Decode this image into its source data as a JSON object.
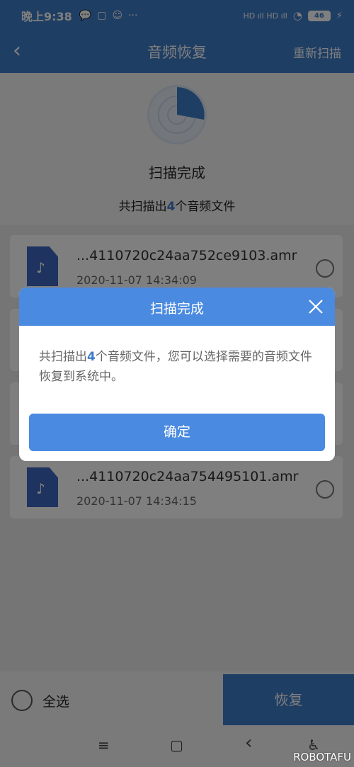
{
  "status_bar": {
    "time": "晚上9:38",
    "app_icons": [
      "💬",
      "▢",
      "☺"
    ],
    "more": "···",
    "signal": "HD ıll HD ıll",
    "wifi": "◔",
    "battery": "46",
    "charging": "⚡"
  },
  "header": {
    "back_icon": "‹",
    "title": "音频恢复",
    "rescan_label": "重新扫描"
  },
  "scan": {
    "status_title": "扫描完成",
    "summary_prefix": "共扫描出",
    "summary_count": "4",
    "summary_suffix": "个音频文件"
  },
  "files": [
    {
      "name": "...4110720c24aa752ce9103.amr",
      "date": "2020-11-07 14:34:09"
    },
    {
      "name": "...4110720c24aa754495101.amr",
      "date": "2020-11-07 14:34:15"
    }
  ],
  "bottom_bar": {
    "select_all_label": "全选",
    "restore_label": "恢复"
  },
  "system_nav": {
    "menu": "≡",
    "home": "▢",
    "back": "‹",
    "accessibility": "♿"
  },
  "watermark": "ROBOTAFU",
  "dialog": {
    "title": "扫描完成",
    "message_prefix": "共扫描出",
    "message_count": "4",
    "message_suffix": "个音频文件，您可以选择需要的音频文件恢复到系统中。",
    "ok_label": "确定"
  },
  "colors": {
    "primary": "#3f7cc8",
    "dialog_header": "#4a8ae0",
    "file_icon": "#3f66c1"
  }
}
